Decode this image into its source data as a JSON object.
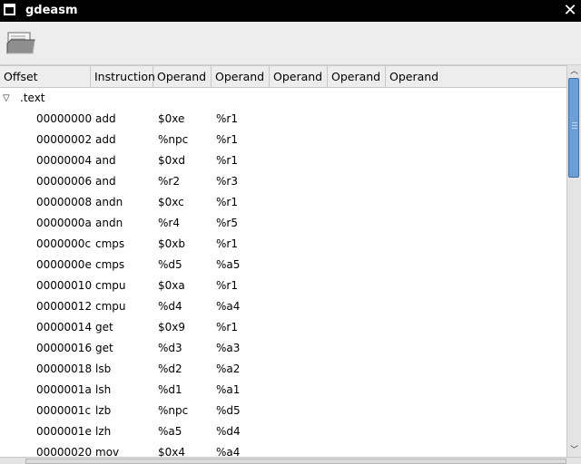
{
  "window": {
    "title": "gdeasm"
  },
  "toolbar": {
    "open_icon": "folder-open-icon"
  },
  "columns": [
    "Offset",
    "Instruction",
    "Operand",
    "Operand",
    "Operand",
    "Operand",
    "Operand"
  ],
  "section": {
    "name": ".text",
    "expanded": true
  },
  "rows": [
    [
      "00000000",
      "add",
      "$0xe",
      "%r1"
    ],
    [
      "00000002",
      "add",
      "%npc",
      "%r1"
    ],
    [
      "00000004",
      "and",
      "$0xd",
      "%r1"
    ],
    [
      "00000006",
      "and",
      "%r2",
      "%r3"
    ],
    [
      "00000008",
      "andn",
      "$0xc",
      "%r1"
    ],
    [
      "0000000a",
      "andn",
      "%r4",
      "%r5"
    ],
    [
      "0000000c",
      "cmps",
      "$0xb",
      "%r1"
    ],
    [
      "0000000e",
      "cmps",
      "%d5",
      "%a5"
    ],
    [
      "00000010",
      "cmpu",
      "$0xa",
      "%r1"
    ],
    [
      "00000012",
      "cmpu",
      "%d4",
      "%a4"
    ],
    [
      "00000014",
      "get",
      "$0x9",
      "%r1"
    ],
    [
      "00000016",
      "get",
      "%d3",
      "%a3"
    ],
    [
      "00000018",
      "lsb",
      "%d2",
      "%a2"
    ],
    [
      "0000001a",
      "lsh",
      "%d1",
      "%a1"
    ],
    [
      "0000001c",
      "lzb",
      "%npc",
      "%d5"
    ],
    [
      "0000001e",
      "lzh",
      "%a5",
      "%d4"
    ],
    [
      "00000020",
      "mov",
      "$0x4",
      "%a4"
    ]
  ]
}
